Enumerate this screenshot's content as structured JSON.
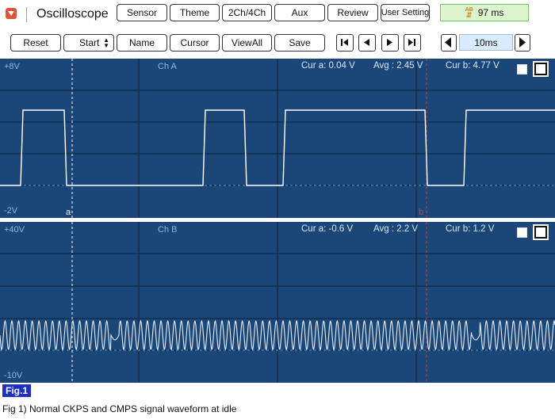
{
  "header": {
    "app_title": "Oscilloscope",
    "buttons": [
      "Sensor",
      "Theme",
      "2Ch/4Ch",
      "Aux",
      "Review",
      "User Setting"
    ],
    "timer_value": "97 ms"
  },
  "toolbar": {
    "reset": "Reset",
    "start": "Start",
    "name": "Name",
    "cursor": "Cursor",
    "viewall": "ViewAll",
    "save": "Save",
    "timebase": "10ms"
  },
  "channel_a": {
    "top_label": "+8V",
    "bottom_label": "-2V",
    "name": "Ch A",
    "cursor_a": "Cur a: 0.04 V",
    "avg": "Avg : 2.45 V",
    "cursor_b": "Cur b: 4.77 V",
    "marker_a": "a",
    "marker_b": "b"
  },
  "channel_b": {
    "top_label": "+40V",
    "bottom_label": "-10V",
    "name": "Ch B",
    "cursor_a": "Cur a: -0.6 V",
    "avg": "Avg : 2.2 V",
    "cursor_b": "Cur b: 1.2 V"
  },
  "colors": {
    "scope_bg": "#1b4778",
    "trace": "#ffffff",
    "cursor_a": "#ffffff",
    "cursor_b": "#d8383a",
    "figure_badge": "#1c2fc9"
  },
  "figure": {
    "badge": "Fig.1",
    "caption": "Fig 1) Normal CKPS and CMPS signal waveform at idle"
  }
}
